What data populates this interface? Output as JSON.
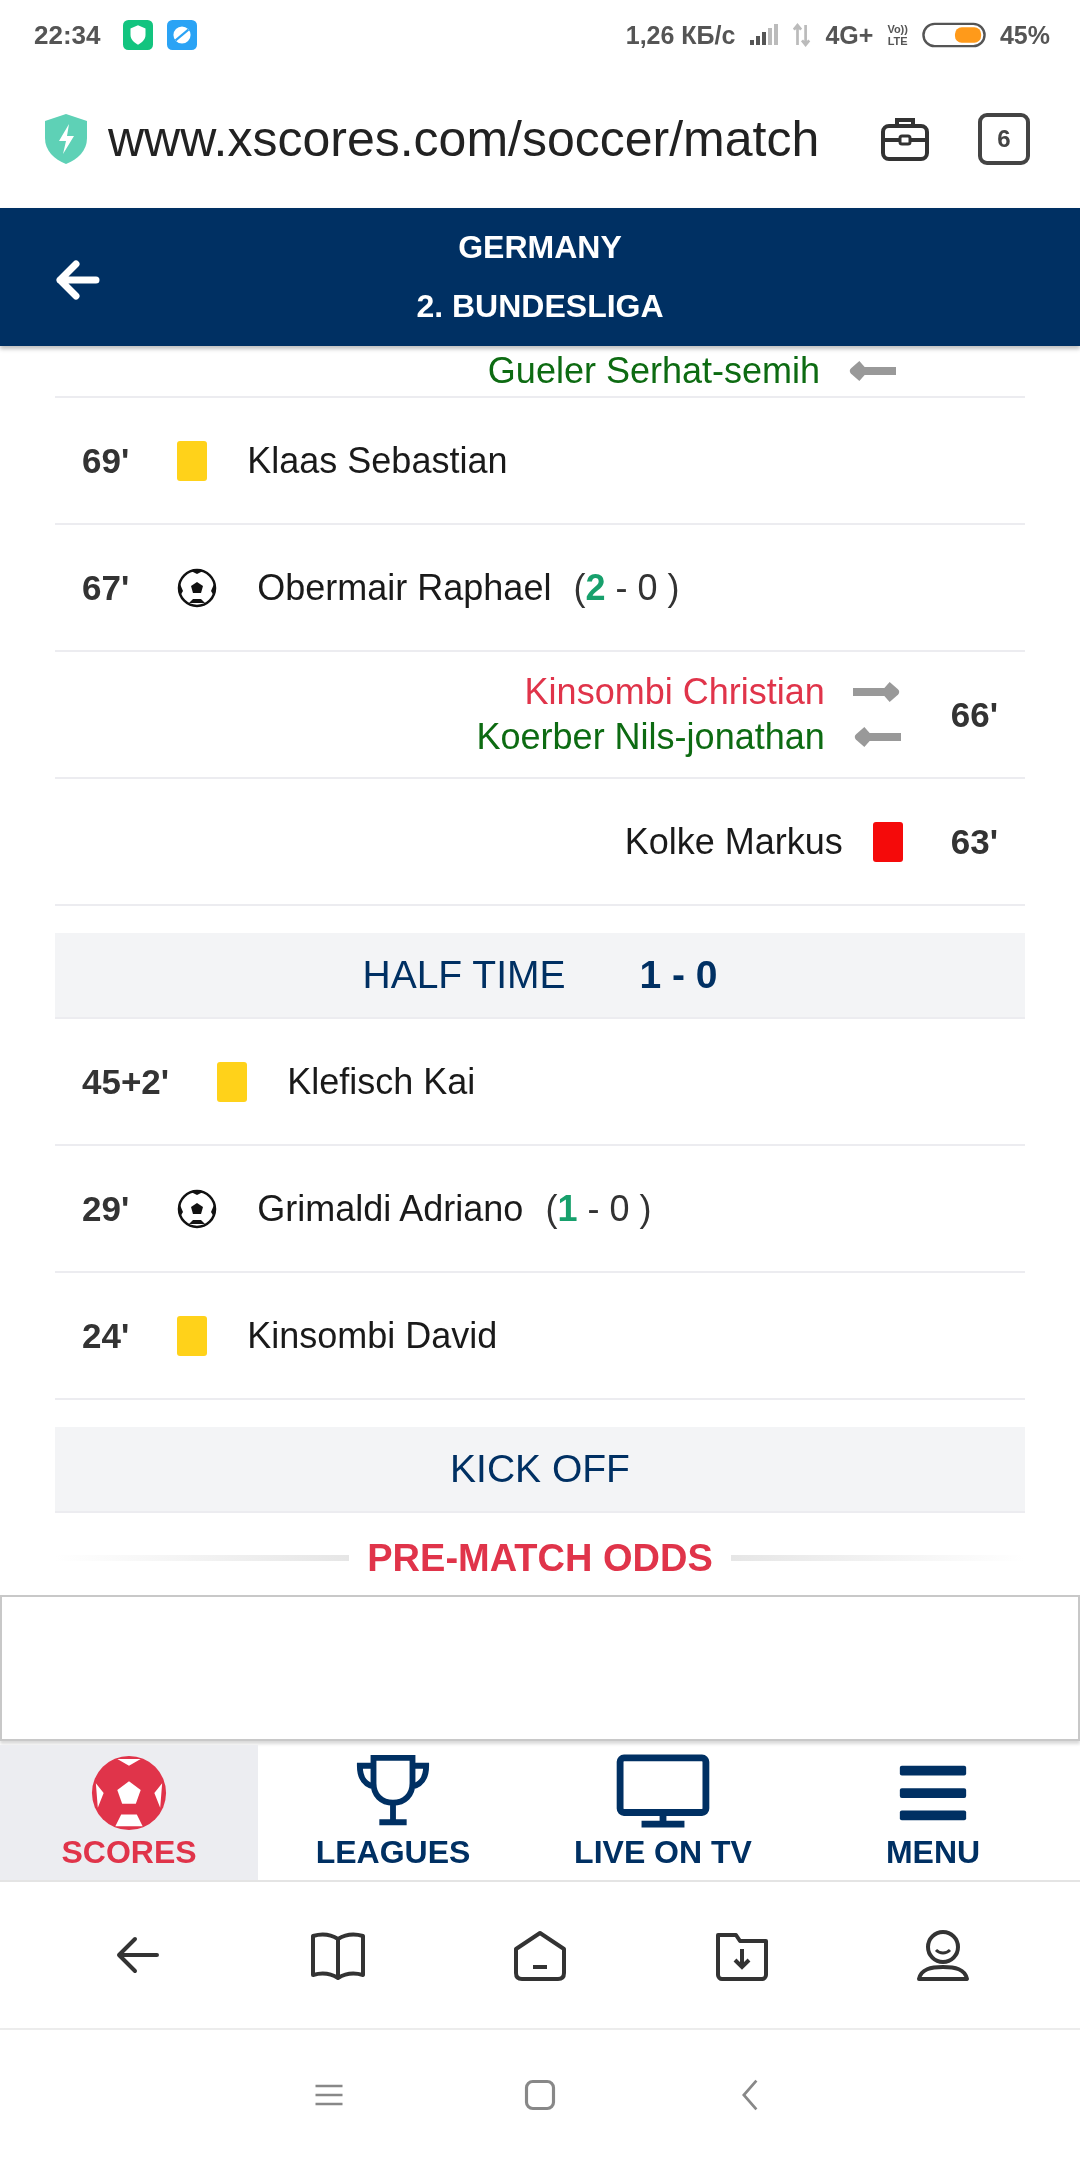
{
  "status_bar": {
    "time": "22:34",
    "speed": "1,26 КБ/с",
    "network": "4G+",
    "volte": [
      "Vo))",
      "LTE"
    ],
    "battery": "45%"
  },
  "browser": {
    "url": "www.xscores.com/soccer/match",
    "tab_count": "6"
  },
  "header": {
    "country": "GERMANY",
    "league": "2. BUNDESLIGA"
  },
  "events": [
    {
      "kind": "sub",
      "away": true,
      "player_in": "Gueler Serhat-semih"
    },
    {
      "kind": "card",
      "away": false,
      "minute": "69'",
      "color": "#ffd21a",
      "player": "Klaas Sebastian"
    },
    {
      "kind": "goal",
      "away": false,
      "minute": "67'",
      "player": "Obermair Raphael",
      "score": "(**2** - 0 )"
    },
    {
      "kind": "sub",
      "away": true,
      "minute": "66'",
      "player_out": "Kinsombi Christian",
      "player_in": "Koerber Nils-jonathan"
    },
    {
      "kind": "card",
      "away": true,
      "minute": "63'",
      "color": "#f50a0a",
      "player": "Kolke Markus"
    },
    {
      "kind": "period",
      "label": "HALF TIME",
      "score": "1 - 0"
    },
    {
      "kind": "card",
      "away": false,
      "minute": "45+2'",
      "color": "#ffd21a",
      "player": "Klefisch Kai"
    },
    {
      "kind": "goal",
      "away": false,
      "minute": "29'",
      "player": "Grimaldi Adriano",
      "score": "(**1** - 0 )"
    },
    {
      "kind": "card",
      "away": false,
      "minute": "24'",
      "color": "#ffd21a",
      "player": "Kinsombi David"
    },
    {
      "kind": "period",
      "label": "KICK OFF"
    }
  ],
  "section_title": "PRE-MATCH ODDS",
  "bottom_nav": [
    {
      "label": "SCORES",
      "selected": true
    },
    {
      "label": "LEAGUES",
      "selected": false
    },
    {
      "label": "LIVE ON TV",
      "selected": false
    },
    {
      "label": "MENU",
      "selected": false
    }
  ]
}
